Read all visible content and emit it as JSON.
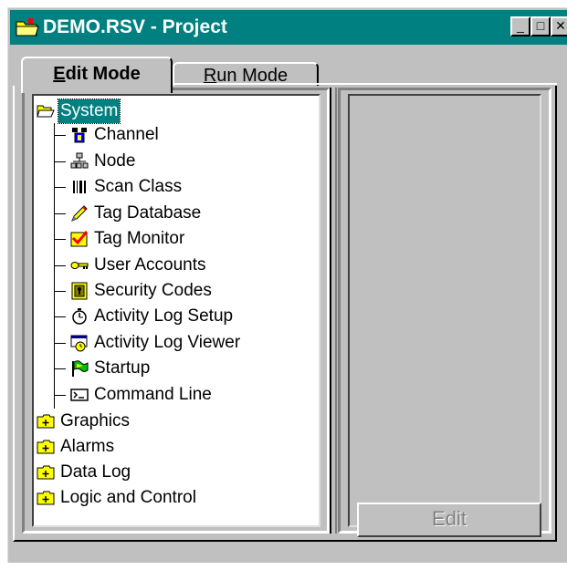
{
  "window": {
    "title": "DEMO.RSV - Project",
    "controls": {
      "minimize": "_",
      "maximize": "□",
      "close": "✕"
    }
  },
  "tabs": [
    {
      "label_first": "E",
      "label_rest": "dit Mode",
      "active": true
    },
    {
      "label_first": "R",
      "label_rest": "un Mode",
      "active": false
    }
  ],
  "tree": {
    "root": {
      "label": "System",
      "icon": "open-folder-icon",
      "expanded": true,
      "selected": true
    },
    "system_children": [
      {
        "label": "Channel",
        "icon": "channel-icon"
      },
      {
        "label": "Node",
        "icon": "network-node-icon"
      },
      {
        "label": "Scan Class",
        "icon": "barcode-icon"
      },
      {
        "label": "Tag Database",
        "icon": "pencil-icon"
      },
      {
        "label": "Tag Monitor",
        "icon": "checkmark-monitor-icon"
      },
      {
        "label": "User Accounts",
        "icon": "key-icon"
      },
      {
        "label": "Security Codes",
        "icon": "keyhole-icon"
      },
      {
        "label": "Activity Log Setup",
        "icon": "stopwatch-icon"
      },
      {
        "label": "Activity Log Viewer",
        "icon": "log-viewer-icon"
      },
      {
        "label": "Startup",
        "icon": "green-flag-icon"
      },
      {
        "label": "Command Line",
        "icon": "command-prompt-icon"
      }
    ],
    "folders": [
      {
        "label": "Graphics",
        "icon": "collapsed-folder-icon"
      },
      {
        "label": "Alarms",
        "icon": "collapsed-folder-icon"
      },
      {
        "label": "Data Log",
        "icon": "collapsed-folder-icon"
      },
      {
        "label": "Logic and Control",
        "icon": "collapsed-folder-icon"
      }
    ]
  },
  "right_panel": {
    "edit_label": "Edit",
    "edit_enabled": false
  },
  "colors": {
    "title_bar": "#008080",
    "face": "#c0c0c0",
    "selection": "#008080",
    "folder": "#ffff00"
  }
}
